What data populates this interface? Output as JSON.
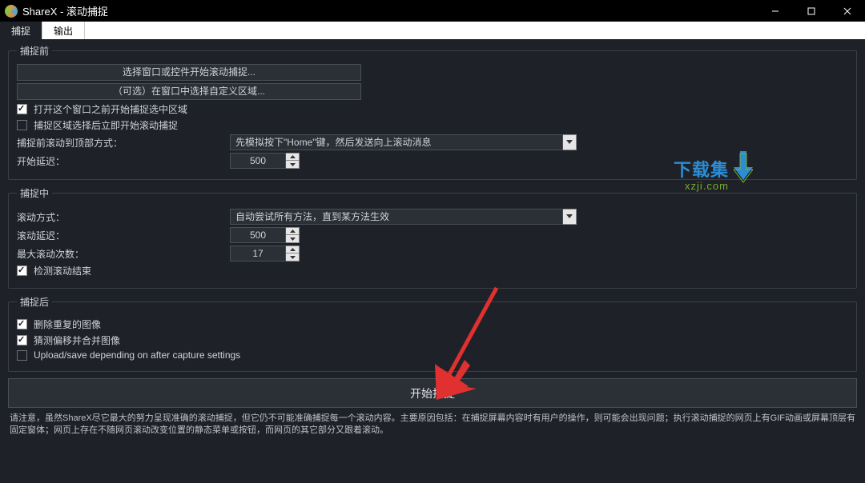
{
  "window": {
    "title": "ShareX - 滚动捕捉"
  },
  "tabs": {
    "capture": "捕捉",
    "output": "输出"
  },
  "before": {
    "legend": "捕捉前",
    "btn_select_window": "选择窗口或控件开始滚动捕捉...",
    "btn_select_region": "（可选）在窗口中选择自定义区域...",
    "chk_open_window": "打开这个窗口之前开始捕捉选中区域",
    "chk_start_after_region": "捕捉区域选择后立即开始滚动捕捉",
    "lbl_scroll_top_method": "捕捉前滚动到顶部方式：",
    "val_scroll_top_method": "先模拟按下\"Home\"键，然后发送向上滚动消息",
    "lbl_start_delay": "开始延迟：",
    "val_start_delay": "500"
  },
  "during": {
    "legend": "捕捉中",
    "lbl_scroll_method": "滚动方式：",
    "val_scroll_method": "自动尝试所有方法，直到某方法生效",
    "lbl_scroll_delay": "滚动延迟：",
    "val_scroll_delay": "500",
    "lbl_max_scroll": "最大滚动次数：",
    "val_max_scroll": "17",
    "chk_detect_end": "检测滚动结束"
  },
  "after": {
    "legend": "捕捉后",
    "chk_remove_dup": "删除重复的图像",
    "chk_guess_offset": "猜测偏移并合并图像",
    "chk_upload_save": "Upload/save depending on after capture settings"
  },
  "start_button": "开始捕捉",
  "note": "请注意，虽然ShareX尽它最大的努力呈现准确的滚动捕捉，但它仍不可能准确捕捉每一个滚动内容。主要原因包括：在捕捉屏幕内容时有用户的操作，则可能会出现问题；执行滚动捕捉的网页上有GIF动画或屏幕顶层有固定窗体；网页上存在不随网页滚动改变位置的静态菜单或按钮，而网页的其它部分又跟着滚动。",
  "watermark": {
    "main": "下载集",
    "sub": "xzji.com"
  }
}
